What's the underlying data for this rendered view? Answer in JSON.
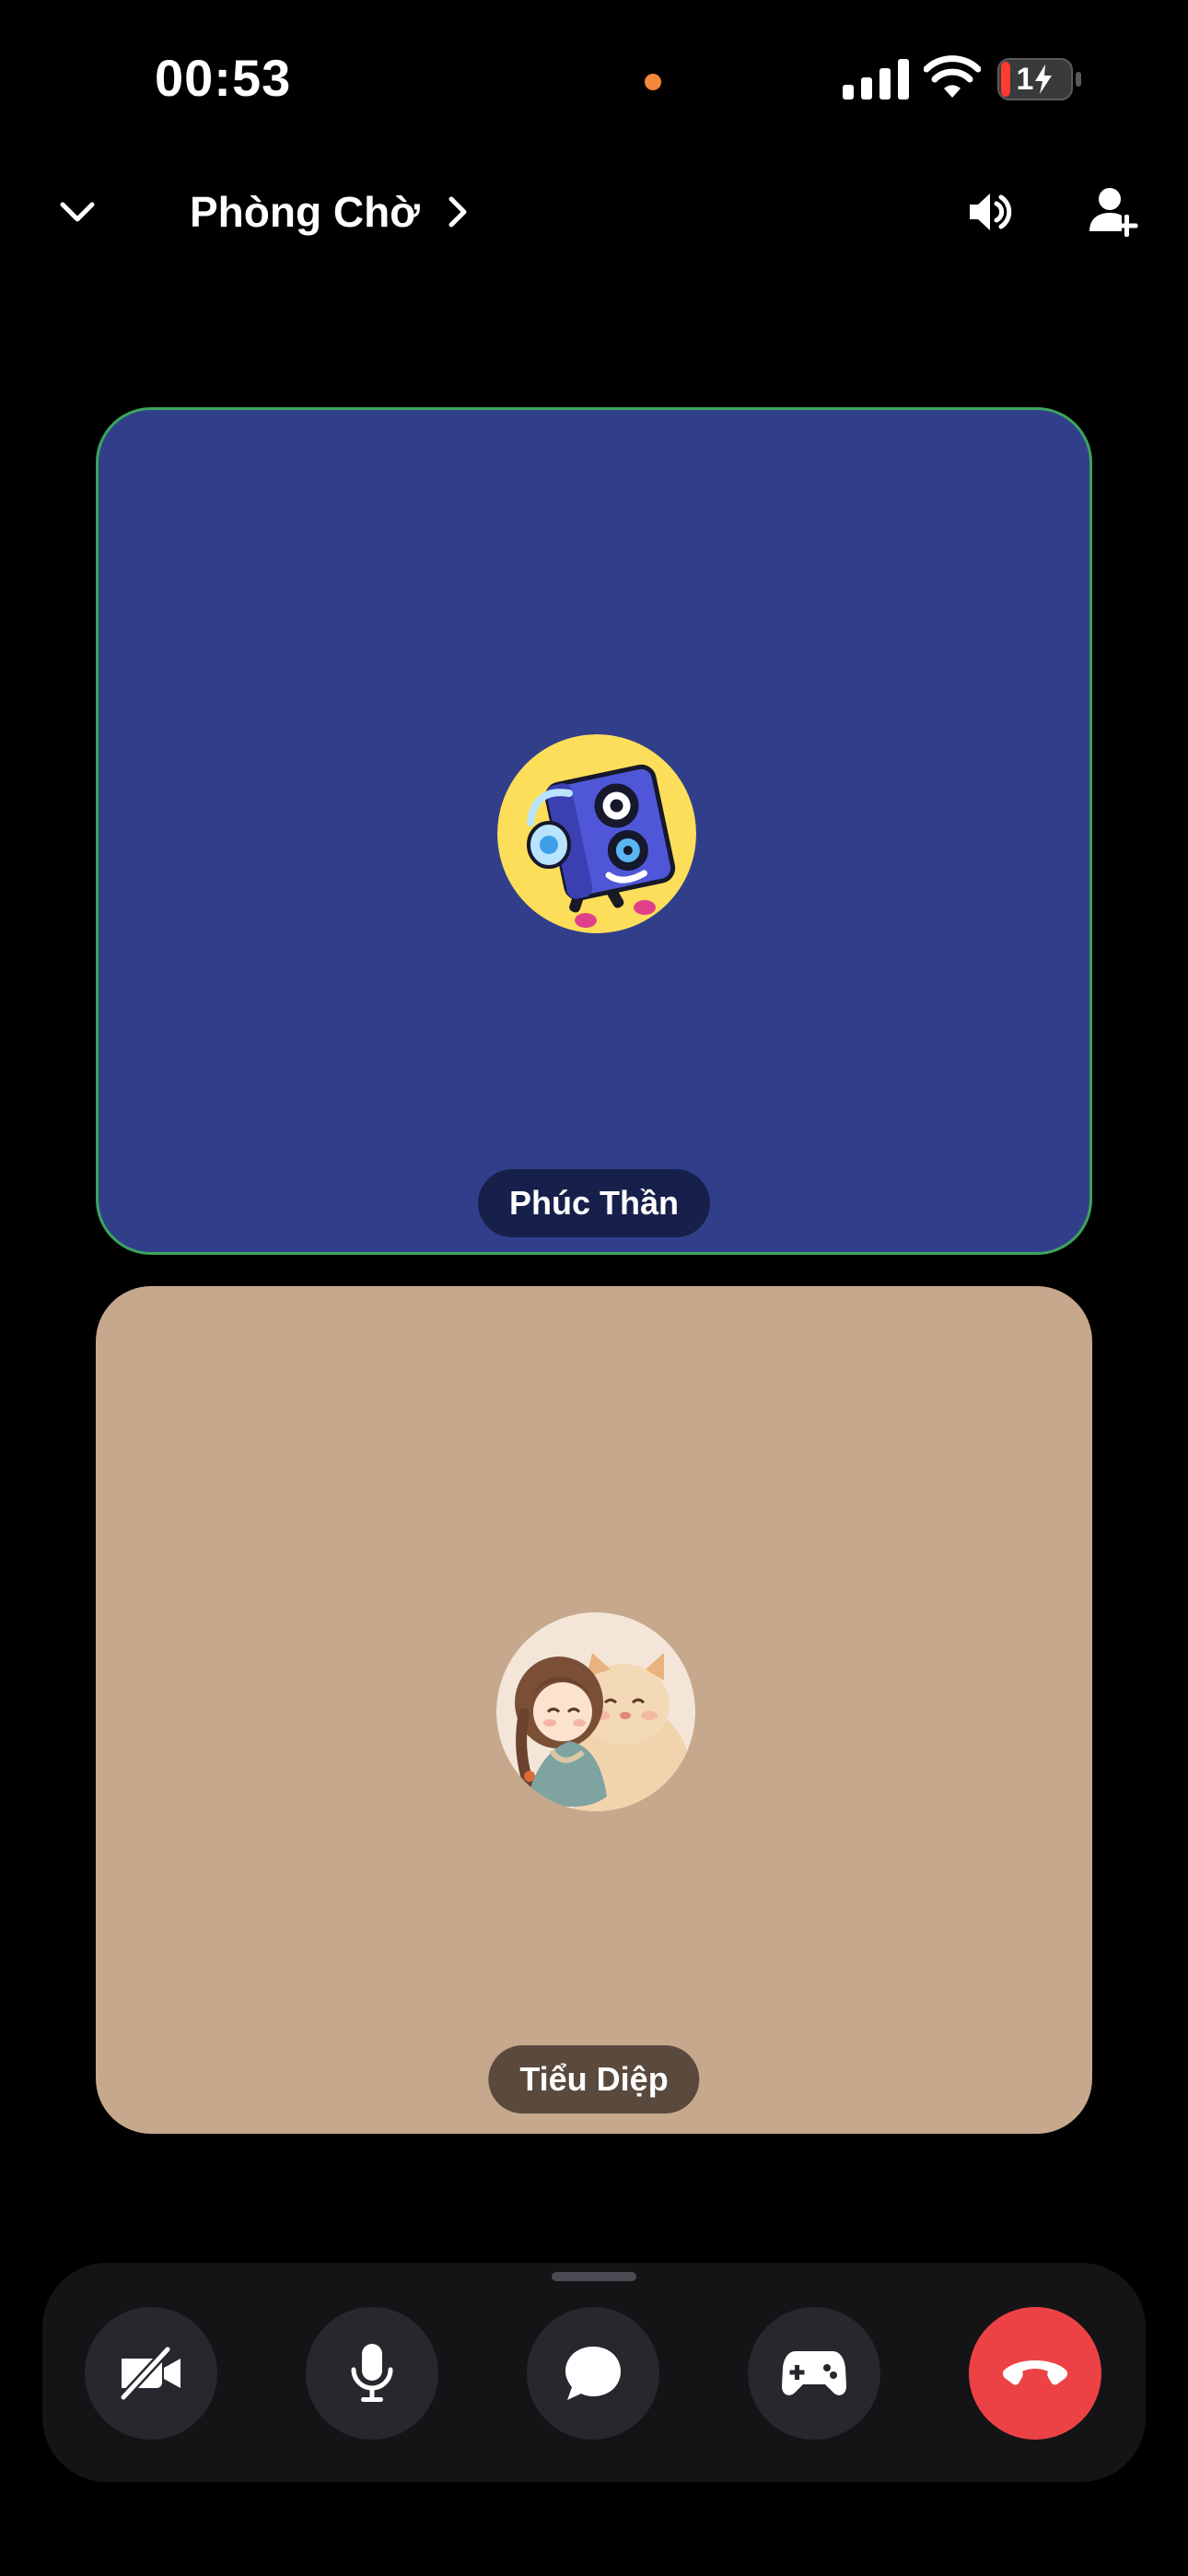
{
  "status_bar": {
    "time": "00:53",
    "battery_level": "14",
    "battery_label": "1",
    "recording_dot_color": "#f5873b"
  },
  "header": {
    "channel_name": "Phòng Chờ"
  },
  "participants": [
    {
      "name": "Phúc Thần",
      "tile_color": "#313f8b",
      "speaking": true,
      "speaking_color": "#3ba55c",
      "pill_color": "#17204a"
    },
    {
      "name": "Tiểu Diệp",
      "tile_color": "#c6a88d",
      "speaking": false,
      "pill_color": "#5a4a3e"
    }
  ],
  "controls": [
    {
      "name": "camera-off",
      "icon": "video-off-icon",
      "color": "#27282d"
    },
    {
      "name": "microphone",
      "icon": "microphone-icon",
      "color": "#27282d"
    },
    {
      "name": "chat",
      "icon": "chat-bubble-icon",
      "color": "#27282d"
    },
    {
      "name": "activities",
      "icon": "gamepad-icon",
      "color": "#27282d"
    },
    {
      "name": "disconnect",
      "icon": "hang-up-icon",
      "color": "#ed4245"
    }
  ]
}
